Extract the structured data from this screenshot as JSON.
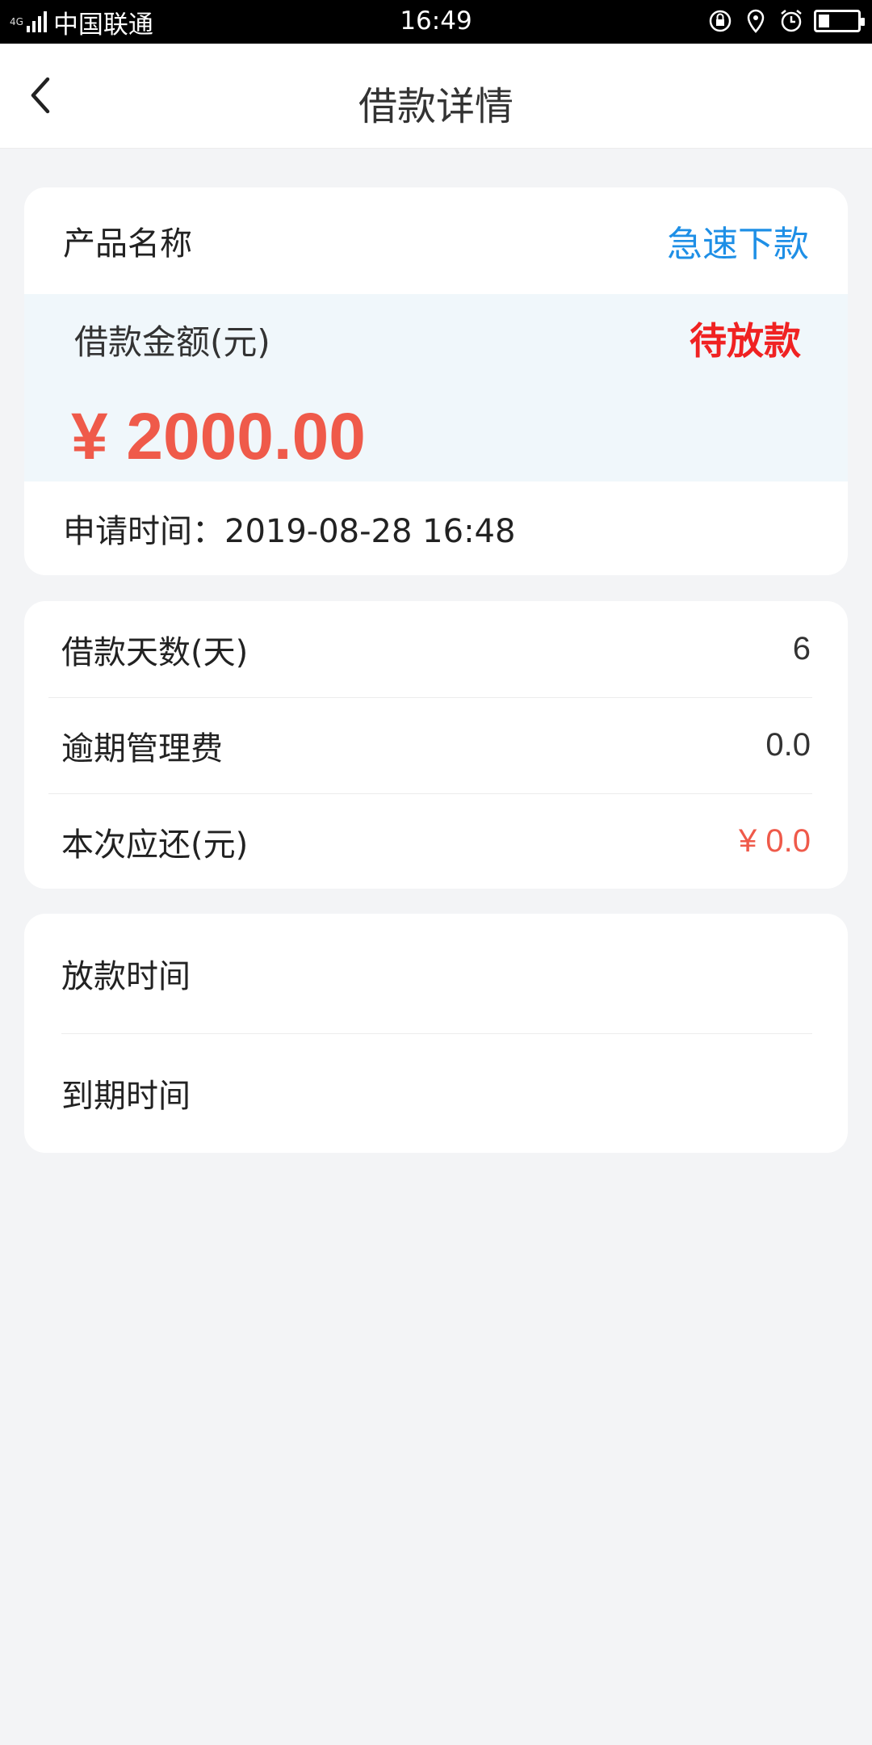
{
  "status_bar": {
    "network": "4G",
    "carrier": "中国联通",
    "time": "16:49",
    "icons": [
      "lock-rotation-icon",
      "location-icon",
      "alarm-icon",
      "battery-icon"
    ]
  },
  "header": {
    "title": "借款详情",
    "back_icon": "chevron-left-icon"
  },
  "loan_card": {
    "product_label": "产品名称",
    "product_value": "急速下款",
    "amount_label": "借款金额(元)",
    "status": "待放款",
    "amount": "¥ 2000.00",
    "apply_time": "申请时间：2019-08-28 16:48"
  },
  "details": [
    {
      "label": "借款天数(天)",
      "value": "6"
    },
    {
      "label": "逾期管理费",
      "value": "0.0"
    },
    {
      "label": "本次应还(元)",
      "value": "¥ 0.0"
    }
  ],
  "times": [
    {
      "label": "放款时间"
    },
    {
      "label": "到期时间"
    }
  ],
  "colors": {
    "accent_blue": "#1e8fe6",
    "status_red": "#f02222",
    "amount_red": "#ef5a4a",
    "background": "#f3f4f6"
  }
}
